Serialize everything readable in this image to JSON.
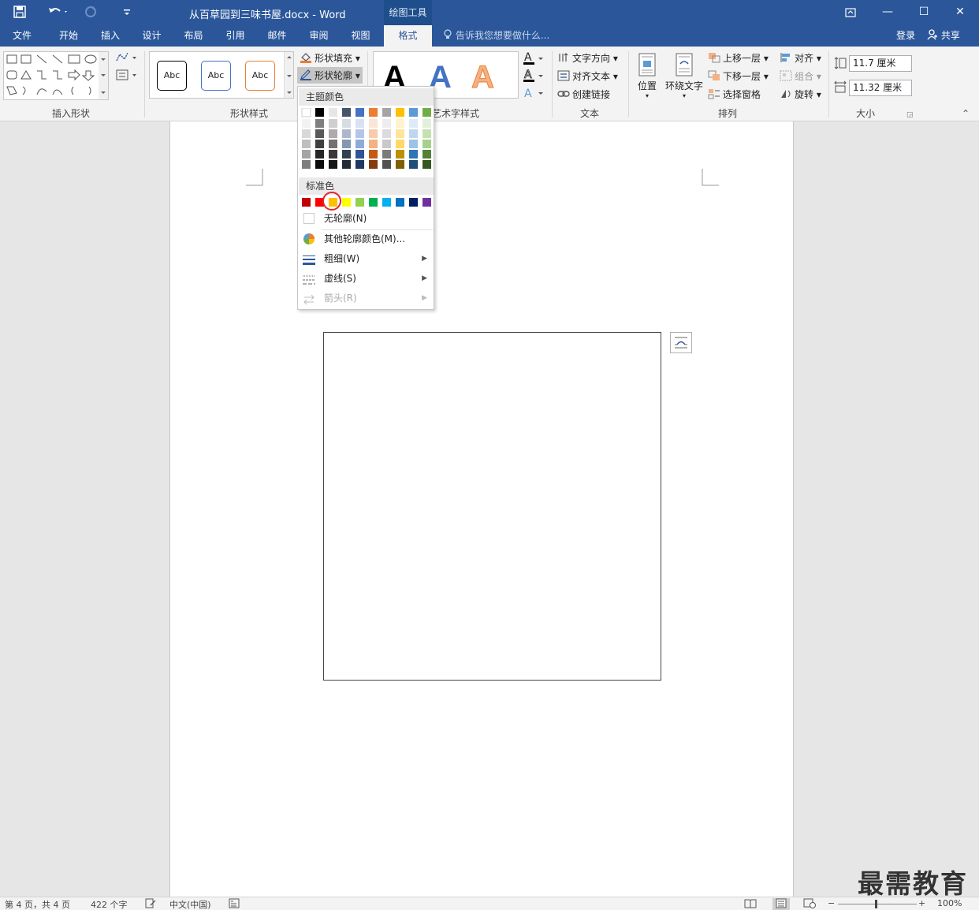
{
  "titlebar": {
    "doc_title": "从百草园到三味书屋.docx - Word",
    "context_tab": "绘图工具",
    "restore_glyph": "⧉",
    "minimize_glyph": "—",
    "maximize_glyph": "☐",
    "close_glyph": "✕"
  },
  "tabs": [
    {
      "label": "文件"
    },
    {
      "label": "开始"
    },
    {
      "label": "插入"
    },
    {
      "label": "设计"
    },
    {
      "label": "布局"
    },
    {
      "label": "引用"
    },
    {
      "label": "邮件"
    },
    {
      "label": "审阅"
    },
    {
      "label": "视图"
    },
    {
      "label": "格式",
      "active": true
    }
  ],
  "tellme": "告诉我您想要做什么...",
  "login": "登录",
  "share": "共享",
  "ribbon": {
    "insert_shapes": {
      "label": "插入形状"
    },
    "shape_styles": {
      "label": "形状样式",
      "swatch_text": "Abc",
      "fill": "形状填充",
      "outline": "形状轮廓"
    },
    "wordart": {
      "label": "艺术字样式",
      "letter": "A"
    },
    "text": {
      "label": "文本",
      "direction": "文字方向",
      "align": "对齐文本",
      "link": "创建链接"
    },
    "arrange": {
      "label": "排列",
      "position": "位置",
      "wrap": "环绕文字",
      "forward": "上移一层",
      "backward": "下移一层",
      "pane": "选择窗格",
      "align": "对齐",
      "group": "组合",
      "rotate": "旋转"
    },
    "size": {
      "label": "大小",
      "height": "11.7 厘米",
      "width": "11.32 厘米"
    }
  },
  "outline_menu": {
    "theme_colors_label": "主题颜色",
    "standard_colors_label": "标准色",
    "no_outline": "无轮廓(N)",
    "more_colors": "其他轮廓颜色(M)...",
    "weight": "粗细(W)",
    "dashes": "虚线(S)",
    "arrows": "箭头(R)",
    "theme_top": [
      "#ffffff",
      "#000000",
      "#e7e6e6",
      "#44546a",
      "#4472c4",
      "#ed7d31",
      "#a5a5a5",
      "#ffc000",
      "#5b9bd5",
      "#70ad47"
    ],
    "theme_shades": [
      [
        "#f2f2f2",
        "#7f7f7f",
        "#d0cece",
        "#d6dce4",
        "#d9e2f3",
        "#fbe5d5",
        "#ededed",
        "#fff2cc",
        "#deebf6",
        "#e2efd9"
      ],
      [
        "#d8d8d8",
        "#595959",
        "#aeabab",
        "#adb9ca",
        "#b4c6e7",
        "#f7cbac",
        "#dbdbdb",
        "#fee599",
        "#bdd7ee",
        "#c5e0b3"
      ],
      [
        "#bfbfbf",
        "#3f3f3f",
        "#757070",
        "#8496b0",
        "#8eaadb",
        "#f4b183",
        "#c9c9c9",
        "#ffd965",
        "#9cc3e5",
        "#a8d08d"
      ],
      [
        "#a5a5a5",
        "#262626",
        "#3a3838",
        "#323f4f",
        "#2f5496",
        "#c55a11",
        "#7b7b7b",
        "#bf9000",
        "#2e75b5",
        "#538135"
      ],
      [
        "#7f7f7f",
        "#0c0c0c",
        "#171616",
        "#222a35",
        "#1f3864",
        "#833c0b",
        "#525252",
        "#7f6000",
        "#1e4e79",
        "#375623"
      ]
    ],
    "standard": [
      "#c00000",
      "#ff0000",
      "#ffc000",
      "#ffff00",
      "#92d050",
      "#00b050",
      "#00b0f0",
      "#0070c0",
      "#002060",
      "#7030a0"
    ]
  },
  "statusbar": {
    "page": "第 4 页，共 4 页",
    "words": "422 个字",
    "language": "中文(中国)",
    "zoom": "100%"
  },
  "watermark": "最需教育"
}
